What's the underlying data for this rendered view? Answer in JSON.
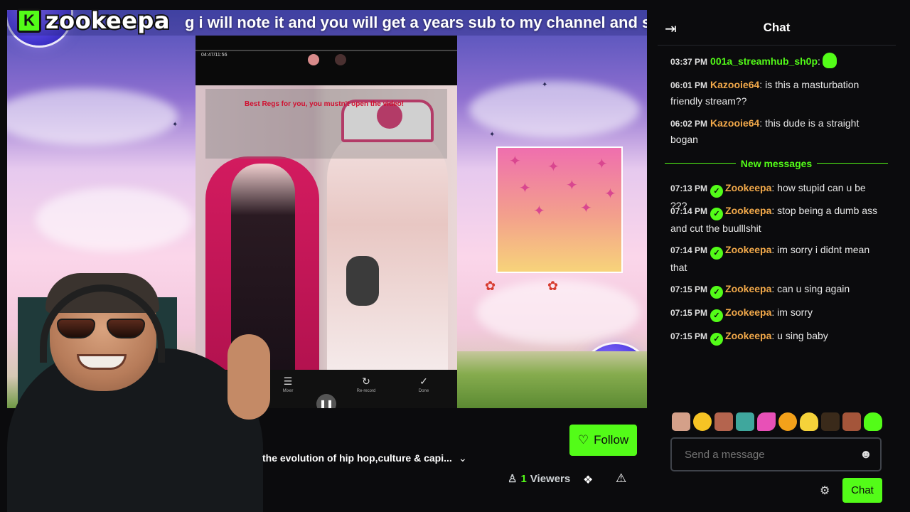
{
  "brand": {
    "logo_text": "zookeepa",
    "logo_badge": "K"
  },
  "stream": {
    "ticker_text": "g i will note it and you will get a years sub to my channel and substack se",
    "phone": {
      "timecode": "04:47/11:56",
      "overlay_title": "Best Regs for you, you mustn't open the video!",
      "controls": [
        {
          "label": "Mixer",
          "icon": "sliders-icon"
        },
        {
          "label": "Re-record",
          "icon": "re-record-icon"
        },
        {
          "label": "Done",
          "icon": "done-icon"
        }
      ]
    },
    "title": "the evolution of hip hop,culture & capi...",
    "follow_label": "Follow",
    "viewers_count": "1",
    "viewers_label": "Viewers"
  },
  "chat": {
    "title": "Chat",
    "new_messages_label": "New messages",
    "messages": [
      {
        "time": "03:37 PM",
        "user": "001a_streamhub_sh0p",
        "user_color": "#53fc18",
        "verified": false,
        "text": ""
      },
      {
        "time": "06:01 PM",
        "user": "Kazooie64",
        "user_color": "#f2a94a",
        "verified": false,
        "text": "is this a masturbation friendly stream??"
      },
      {
        "time": "06:02 PM",
        "user": "Kazooie64",
        "user_color": "#f2a94a",
        "verified": false,
        "text": "this dude is a straight bogan"
      },
      {
        "time": "07:13 PM",
        "user": "Zookeepa",
        "user_color": "#f2a94a",
        "verified": true,
        "text": "how stupid can u be ???"
      },
      {
        "time": "07:14 PM",
        "user": "Zookeepa",
        "user_color": "#f2a94a",
        "verified": true,
        "text": "stop being a dumb ass and cut the buulllshit"
      },
      {
        "time": "07:14 PM",
        "user": "Zookeepa",
        "user_color": "#f2a94a",
        "verified": true,
        "text": "im sorry i didnt mean that"
      },
      {
        "time": "07:15 PM",
        "user": "Zookeepa",
        "user_color": "#f2a94a",
        "verified": true,
        "text": "can u sing again"
      },
      {
        "time": "07:15 PM",
        "user": "Zookeepa",
        "user_color": "#f2a94a",
        "verified": true,
        "text": "im sorry"
      },
      {
        "time": "07:15 PM",
        "user": "Zookeepa",
        "user_color": "#f2a94a",
        "verified": true,
        "text": "u sing baby"
      }
    ],
    "input_placeholder": "Send a message",
    "send_label": "Chat"
  },
  "colors": {
    "accent": "#53fc18",
    "background": "#0b0b0d",
    "username": "#f2a94a"
  }
}
